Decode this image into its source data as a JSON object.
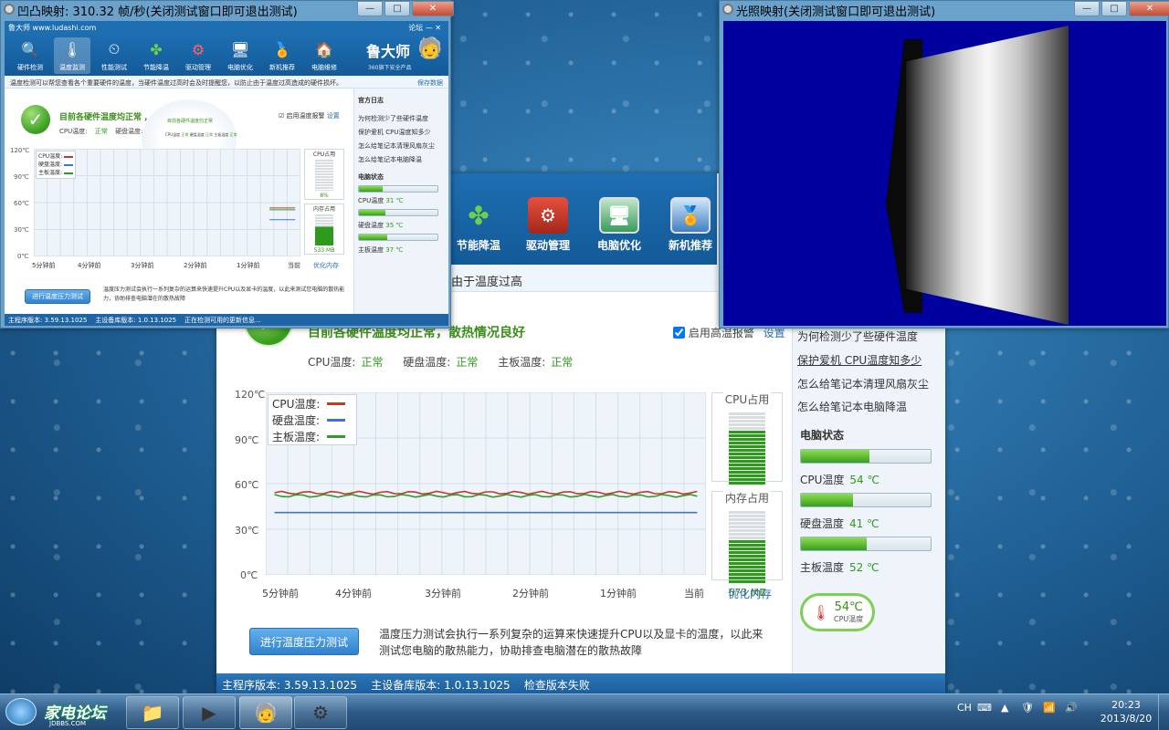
{
  "small_window": {
    "title": "凹凸映射: 310.32 帧/秒(关闭测试窗口即可退出测试)",
    "app_title": "鲁大师 www.ludashi.com",
    "login": "论坛",
    "brand": "鲁大师",
    "brand_sub": "360旗下安全产品",
    "toolbar": [
      "硬件检测",
      "温度监测",
      "性能测试",
      "节能降温",
      "驱动管理",
      "电脑优化",
      "新机推荐",
      "电脑维修"
    ],
    "tip": "温度检测可以帮您查看各个重要硬件的温度，当硬件温度过高时会及时提醒您，以防止由于温度过高造成的硬件损坏。",
    "save_log": "保存数据",
    "status_title": "目前各硬件温度均正常",
    "sub_status": [
      "CPU温度:",
      "正常",
      "硬盘温度:"
    ],
    "tiny_status": [
      "CPU温度",
      "硬盘温度",
      "主板温度",
      "正常"
    ],
    "alarm": "启用温度报警",
    "alarm_settings": "设置",
    "y_ticks": [
      "120℃",
      "90℃",
      "60℃",
      "30℃",
      "0℃"
    ],
    "legend": [
      "CPU温度:",
      "硬盘温度:",
      "主板温度:"
    ],
    "x_ticks": [
      "5分钟前",
      "4分钟前",
      "3分钟前",
      "2分钟前",
      "1分钟前",
      "当前"
    ],
    "cpu_usage_title": "CPU占用",
    "cpu_usage": "8%",
    "mem_title": "内存占用",
    "mem": "533 MB",
    "optimize_mem": "优化内存",
    "stress_button": "进行温度压力测试",
    "stress_desc": "温度压力测试会执行一系列复杂的运算来快速提升CPU以及显卡的温度，以此来测试您电脑的散热能力，协助排查电脑潜在的散热故障",
    "side_head": "官方日志",
    "side_links": [
      "为何检测少了些硬件温度",
      "保护爱机 CPU温度知多少",
      "怎么给笔记本清理风扇灰尘",
      "怎么给笔记本电脑降温"
    ],
    "pc_status": "电脑状态",
    "temps": [
      {
        "label": "CPU温度",
        "value": "31 ℃",
        "fill": 0.3
      },
      {
        "label": "硬盘温度",
        "value": "35 ℃",
        "fill": 0.34
      },
      {
        "label": "主板温度",
        "value": "37 ℃",
        "fill": 0.36
      }
    ],
    "footer": "主程序版本: 3.59.13.1025    主设备库版本: 1.0.13.1025    正在检测可用的更新信息..."
  },
  "light_window": {
    "title": "光照映射(关闭测试窗口即可退出测试)"
  },
  "main_window": {
    "toolbar": [
      {
        "label": "节能降温",
        "icon": "clover-icon"
      },
      {
        "label": "驱动管理",
        "icon": "driver-box-icon"
      },
      {
        "label": "电脑优化",
        "icon": "monitor-optimize-icon"
      },
      {
        "label": "新机推荐",
        "icon": "monitor-award-icon"
      }
    ],
    "tip": "，当硬件温度过高时会及时提醒您，以防止由于温度过高",
    "status_title": "目前各硬件温度均正常，散热情况良好",
    "cpu_label": "CPU温度:",
    "cpu_state": "正常",
    "disk_label": "硬盘温度:",
    "disk_state": "正常",
    "board_label": "主板温度:",
    "board_state": "正常",
    "alarm": "启用高温报警",
    "alarm_settings": "设置",
    "y_ticks": [
      "120℃",
      "90℃",
      "60℃",
      "30℃",
      "0℃"
    ],
    "legend": [
      {
        "name": "CPU温度:",
        "color": "#c23b2a"
      },
      {
        "name": "硬盘温度:",
        "color": "#3c78c8"
      },
      {
        "name": "主板温度:",
        "color": "#2f9a2a"
      }
    ],
    "x_ticks": [
      "5分钟前",
      "4分钟前",
      "3分钟前",
      "2分钟前",
      "1分钟前",
      "当前"
    ],
    "cpu_usage_title": "CPU占用",
    "cpu_usage": "75%",
    "cpu_usage_fraction": 0.75,
    "mem_title": "内存占用",
    "mem": "573 MB",
    "mem_fraction": 0.62,
    "optimize_mem": "优化内存",
    "stress_button": "进行温度压力测试",
    "stress_desc_1": "温度压力测试会执行一系列复杂的运算来快速提升CPU以及显卡的温度，以此来",
    "stress_desc_2": "测试您电脑的散热能力，协助排查电脑潜在的散热故障",
    "side_links": [
      "为何检测少了些硬件温度",
      "保护爱机 CPU温度知多少",
      "怎么给笔记本清理风扇灰尘",
      "怎么给笔记本电脑降温"
    ],
    "pc_status": "电脑状态",
    "temps": [
      {
        "label": "CPU温度",
        "value": "54 ℃",
        "fill": 0.53
      },
      {
        "label": "硬盘温度",
        "value": "41 ℃",
        "fill": 0.4
      },
      {
        "label": "主板温度",
        "value": "52 ℃",
        "fill": 0.51
      }
    ],
    "gauge_value": "54℃",
    "gauge_label": "CPU温度",
    "footer": "主程序版本: 3.59.13.1025    主设备库版本: 1.0.13.1025    检查版本失败"
  },
  "chart_data": {
    "type": "line",
    "x": [
      "5分钟前",
      "4分钟前",
      "3分钟前",
      "2分钟前",
      "1分钟前",
      "当前"
    ],
    "ylim": [
      0,
      120
    ],
    "y_ticks": [
      "120℃",
      "90℃",
      "60℃",
      "30℃",
      "0℃"
    ],
    "grid": true,
    "legend": "top-left",
    "series": [
      {
        "name": "CPU温度:",
        "color": "#c23b2a",
        "values": [
          54,
          54,
          54,
          54,
          54,
          54
        ]
      },
      {
        "name": "硬盘温度:",
        "color": "#3c78c8",
        "values": [
          41,
          41,
          41,
          41,
          41,
          41
        ]
      },
      {
        "name": "主板温度:",
        "color": "#2f9a2a",
        "values": [
          52,
          52,
          52,
          52,
          52,
          52
        ]
      }
    ]
  },
  "taskbar": {
    "logo": "家电论坛",
    "logo_sub": "JDBBS.COM",
    "lang": "CH",
    "time": "20:23",
    "date": "2013/8/20"
  }
}
